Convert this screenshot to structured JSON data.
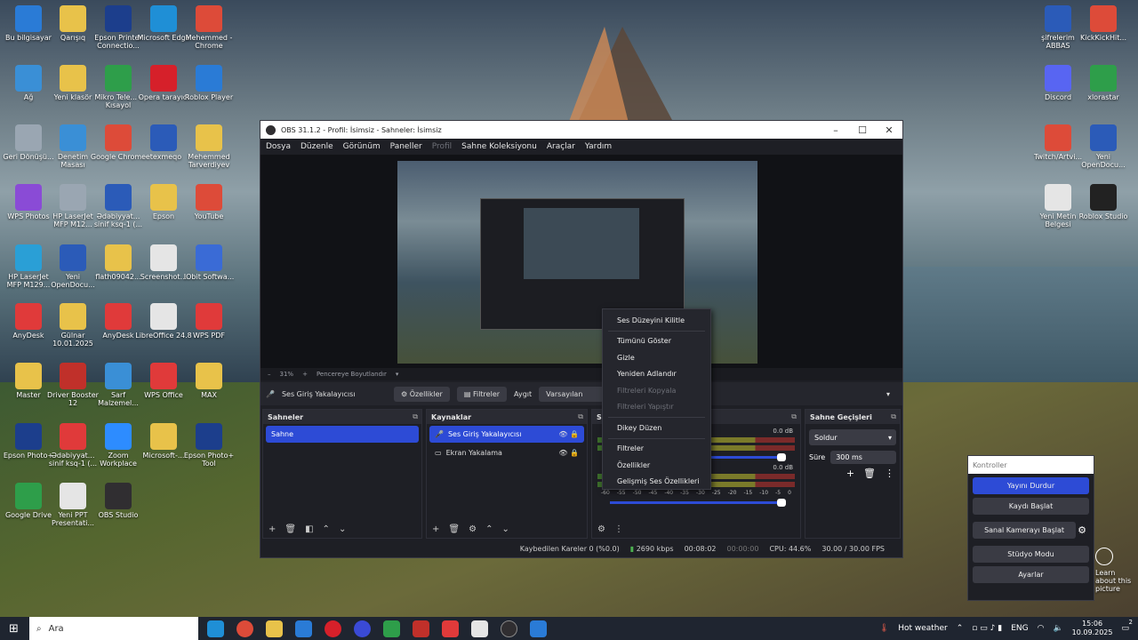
{
  "desktop_icons": [
    {
      "label": "Bu bilgisayar",
      "icon": "computer-icon",
      "color": "#2a7bd6"
    },
    {
      "label": "Qarışıq",
      "icon": "folder-icon",
      "color": "#e8c24a"
    },
    {
      "label": "Epson Printer Connectio...",
      "icon": "printer-icon",
      "color": "#1c3e8c"
    },
    {
      "label": "Microsoft Edge",
      "icon": "edge-icon",
      "color": "#1f8fd6"
    },
    {
      "label": "Mehemmed - Chrome",
      "icon": "chrome-icon",
      "color": "#dd4b39"
    },
    {
      "label": "Ağ",
      "icon": "network-icon",
      "color": "#3a8fd6"
    },
    {
      "label": "Yeni klasör",
      "icon": "folder-icon",
      "color": "#e8c24a"
    },
    {
      "label": "Mikro Tele... - Kısayol",
      "icon": "app-icon",
      "color": "#2e9e4a"
    },
    {
      "label": "Opera tarayıcı",
      "icon": "opera-icon",
      "color": "#d6202a"
    },
    {
      "label": "Roblox Player",
      "icon": "roblox-icon",
      "color": "#2a7bd6"
    },
    {
      "label": "Geri Dönüşü...",
      "icon": "recycle-bin-icon",
      "color": "#9aa6b2"
    },
    {
      "label": "Denetim Masası",
      "icon": "control-panel-icon",
      "color": "#3a8fd6"
    },
    {
      "label": "Google Chrome",
      "icon": "chrome-icon",
      "color": "#dd4b39"
    },
    {
      "label": "etexmeqo",
      "icon": "word-icon",
      "color": "#2b5bb8"
    },
    {
      "label": "Mehemmed Tarverdiyev",
      "icon": "user-folder-icon",
      "color": "#e8c24a"
    },
    {
      "label": "WPS Photos",
      "icon": "photos-icon",
      "color": "#8a4bd6"
    },
    {
      "label": "HP LaserJet MFP M12...",
      "icon": "printer-icon",
      "color": "#9aa6b2"
    },
    {
      "label": "Ədəbiyyat... sinif ksq-1 (...",
      "icon": "word-icon",
      "color": "#2b5bb8"
    },
    {
      "label": "Epson",
      "icon": "folder-icon",
      "color": "#e8c24a"
    },
    {
      "label": "YouTube",
      "icon": "chrome-icon",
      "color": "#dd4b39"
    },
    {
      "label": "HP LaserJet MFP M129...",
      "icon": "scanner-icon",
      "color": "#2a9fd6"
    },
    {
      "label": "Yeni OpenDocu...",
      "icon": "word-icon",
      "color": "#2b5bb8"
    },
    {
      "label": "flath09042...",
      "icon": "folder-icon",
      "color": "#e8c24a"
    },
    {
      "label": "Screenshot...",
      "icon": "document-icon",
      "color": "#e5e5e5"
    },
    {
      "label": "IObit Softwa...",
      "icon": "iobit-icon",
      "color": "#3a6bd6"
    },
    {
      "label": "AnyDesk",
      "icon": "anydesk-icon",
      "color": "#e03a3a"
    },
    {
      "label": "Gülnar 10.01.2025",
      "icon": "folder-icon",
      "color": "#e8c24a"
    },
    {
      "label": "AnyDesk",
      "icon": "anydesk-icon",
      "color": "#e03a3a"
    },
    {
      "label": "LibreOffice 24.8",
      "icon": "libreoffice-icon",
      "color": "#e5e5e5"
    },
    {
      "label": "WPS PDF",
      "icon": "pdf-icon",
      "color": "#e03a3a"
    },
    {
      "label": "Master",
      "icon": "folder-icon",
      "color": "#e8c24a"
    },
    {
      "label": "Driver Booster 12",
      "icon": "driver-booster-icon",
      "color": "#c0302a"
    },
    {
      "label": "Sarf Malzemel...",
      "icon": "app-icon",
      "color": "#3a8fd6"
    },
    {
      "label": "WPS Office",
      "icon": "wps-office-icon",
      "color": "#e03a3a"
    },
    {
      "label": "MAX",
      "icon": "folder-icon",
      "color": "#e8c24a"
    },
    {
      "label": "Epson Photo+",
      "icon": "epson-icon",
      "color": "#1c3e8c"
    },
    {
      "label": "Ədəbiyyat... sinif ksq-1 (...",
      "icon": "pdf-icon",
      "color": "#e03a3a"
    },
    {
      "label": "Zoom Workplace",
      "icon": "zoom-icon",
      "color": "#2d8cff"
    },
    {
      "label": "Microsoft-...",
      "icon": "folder-icon",
      "color": "#e8c24a"
    },
    {
      "label": "Epson Photo+ Tool",
      "icon": "epson-icon",
      "color": "#1c3e8c"
    },
    {
      "label": "Google Drive",
      "icon": "drive-icon",
      "color": "#2e9e4a"
    },
    {
      "label": "Yeni PPT Presentati...",
      "icon": "ppt-icon",
      "color": "#e5e5e5"
    },
    {
      "label": "OBS Studio",
      "icon": "obs-icon",
      "color": "#302e31"
    },
    {
      "label": "şifrelerim ABBAS",
      "icon": "word-icon",
      "color": "#2b5bb8"
    },
    {
      "label": "KickKickHit...",
      "icon": "chrome-icon",
      "color": "#dd4b39"
    },
    {
      "label": "Discord",
      "icon": "discord-icon",
      "color": "#5865f2"
    },
    {
      "label": "xlorastar",
      "icon": "sheets-icon",
      "color": "#2e9e4a"
    },
    {
      "label": "Twitch/Artvi...",
      "icon": "chrome-icon",
      "color": "#dd4b39"
    },
    {
      "label": "Yeni OpenDocu...",
      "icon": "word-icon",
      "color": "#2b5bb8"
    },
    {
      "label": "Yeni Metin Belgesi",
      "icon": "text-file-icon",
      "color": "#e5e5e5"
    },
    {
      "label": "Roblox Studio",
      "icon": "roblox-studio-icon",
      "color": "#222"
    }
  ],
  "obs": {
    "title": "OBS 31.1.2 - Profil: İsimsiz - Sahneler: İsimsiz",
    "menu": [
      "Dosya",
      "Düzenle",
      "Görünüm",
      "Paneller",
      "Profil",
      "Sahne Koleksiyonu",
      "Araçlar",
      "Yardım"
    ],
    "zoom": "31%",
    "fit_label": "Pencereye Boyutlandır",
    "source_bar": {
      "source_name": "Ses Giriş Yakalayıcısı",
      "properties": "Özellikler",
      "filters": "Filtreler",
      "device_label": "Aygıt",
      "device_value": "Varsayılan"
    },
    "scenes": {
      "title": "Sahneler",
      "items": [
        "Sahne"
      ]
    },
    "sources": {
      "title": "Kaynaklar",
      "items": [
        "Ses Giriş Yakalayıcısı",
        "Ekran Yakalama"
      ]
    },
    "mixer": {
      "title": "Se",
      "db1": "0.0 dB",
      "db2": "0.0 dB",
      "scale": [
        "-60",
        "-55",
        "-50",
        "-45",
        "-40",
        "-35",
        "-30",
        "-25",
        "-20",
        "-15",
        "-10",
        "-5",
        "0"
      ]
    },
    "transitions": {
      "title": "Sahne Geçişleri",
      "type": "Soldur",
      "duration_label": "Süre",
      "duration": "300 ms"
    },
    "status": {
      "dropped": "Kaybedilen Kareler 0 (%0.0)",
      "kbps": "2690 kbps",
      "rec_time": "00:08:02",
      "stream_time": "00:00:00",
      "cpu": "CPU: 44.6%",
      "fps": "30.00 / 30.00 FPS"
    }
  },
  "context_menu": {
    "items": [
      {
        "label": "Ses Düzeyini Kilitle",
        "enabled": true
      },
      {
        "label": "Tümünü Göster",
        "enabled": true
      },
      {
        "label": "Gizle",
        "enabled": true
      },
      {
        "label": "Yeniden Adlandır",
        "enabled": true
      },
      {
        "label": "Filtreleri Kopyala",
        "enabled": false
      },
      {
        "label": "Filtreleri Yapıştır",
        "enabled": false
      },
      {
        "label": "Dikey Düzen",
        "enabled": true
      },
      {
        "label": "Filtreler",
        "enabled": true
      },
      {
        "label": "Özellikler",
        "enabled": true
      },
      {
        "label": "Gelişmiş Ses Özellikleri",
        "enabled": true
      }
    ]
  },
  "controls": {
    "title": "Kontroller",
    "stop_stream": "Yayını Durdur",
    "start_record": "Kaydı Başlat",
    "virtual_cam": "Sanal Kamerayı Başlat",
    "studio_mode": "Stüdyo Modu",
    "settings": "Ayarlar"
  },
  "learn_more": "Learn about this picture",
  "taskbar": {
    "search_placeholder": "Ara",
    "weather": "Hot weather",
    "lang": "ENG",
    "time": "15:06",
    "date": "10.09.2025",
    "notifications": "2"
  }
}
